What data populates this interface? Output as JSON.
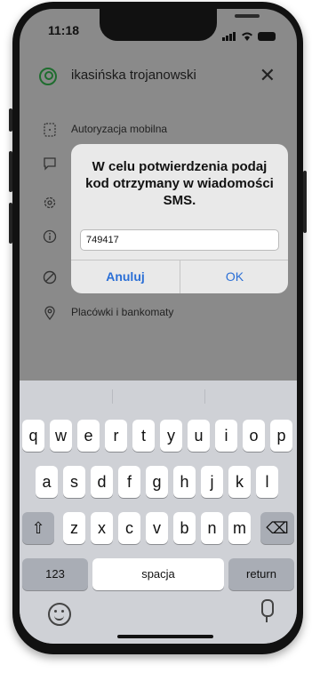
{
  "status_bar": {
    "time": "11:18"
  },
  "header": {
    "user_name": "ikasińska trojanowski",
    "close_symbol": "✕"
  },
  "menu": [
    {
      "label": "Autoryzacja mobilna",
      "icon": "mobile-auth-icon"
    },
    {
      "label": "",
      "icon": "chat-icon"
    },
    {
      "label": "",
      "icon": "settings-icon"
    },
    {
      "label": "",
      "icon": "info-icon"
    },
    {
      "label": "",
      "icon": "block-icon"
    },
    {
      "label": "Placówki i bankomaty",
      "icon": "location-icon"
    }
  ],
  "dialog": {
    "message": "W celu potwierdzenia podaj kod otrzymany w wiadomości SMS.",
    "input_value": "749417",
    "cancel_label": "Anuluj",
    "ok_label": "OK"
  },
  "keyboard": {
    "row1": [
      "q",
      "w",
      "e",
      "r",
      "t",
      "y",
      "u",
      "i",
      "o",
      "p"
    ],
    "row2": [
      "a",
      "s",
      "d",
      "f",
      "g",
      "h",
      "j",
      "k",
      "l"
    ],
    "row3": [
      "z",
      "x",
      "c",
      "v",
      "b",
      "n",
      "m"
    ],
    "shift_symbol": "⇧",
    "backspace_symbol": "⌫",
    "numbers_label": "123",
    "space_label": "spacja",
    "return_label": "return"
  },
  "colors": {
    "accent": "#2b6fd6",
    "brand_green": "#1f6d2f"
  }
}
